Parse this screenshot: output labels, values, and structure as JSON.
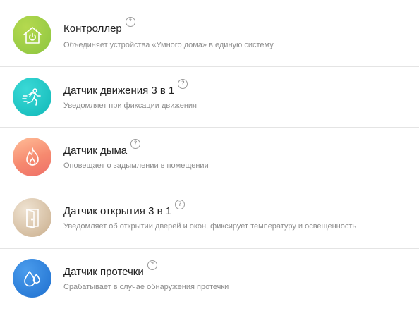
{
  "help_glyph": "?",
  "colors": {
    "controller": [
      "#a9d143",
      "#8bc53f"
    ],
    "motion": [
      "#29d1cf",
      "#10b8b8"
    ],
    "smoke": [
      "#ffb08e",
      "#f27a6a"
    ],
    "opening": [
      "#e9dac6",
      "#cdb394"
    ],
    "leak": [
      "#3a8ee5",
      "#1e6fcf"
    ],
    "icon_stroke": "#ffffff",
    "title": "#222222",
    "subtitle": "#8c8c8c",
    "divider": "#e4e4e4"
  },
  "devices": [
    {
      "icon": "home-power-icon",
      "title": "Контроллер",
      "description": "Объединяет устройства «Умного дома» в единую систему"
    },
    {
      "icon": "running-person-icon",
      "title": "Датчик движения 3 в 1",
      "description": "Уведомляет при фиксации движения"
    },
    {
      "icon": "flame-icon",
      "title": "Датчик дыма",
      "description": "Оповещает о задымлении в помещении"
    },
    {
      "icon": "door-icon",
      "title": "Датчик открытия 3 в 1",
      "description": "Уведомляет об открытии дверей и окон, фиксирует температуру и освещенность"
    },
    {
      "icon": "water-drops-icon",
      "title": "Датчик протечки",
      "description": "Срабатывает в случае обнаружения протечки"
    }
  ]
}
